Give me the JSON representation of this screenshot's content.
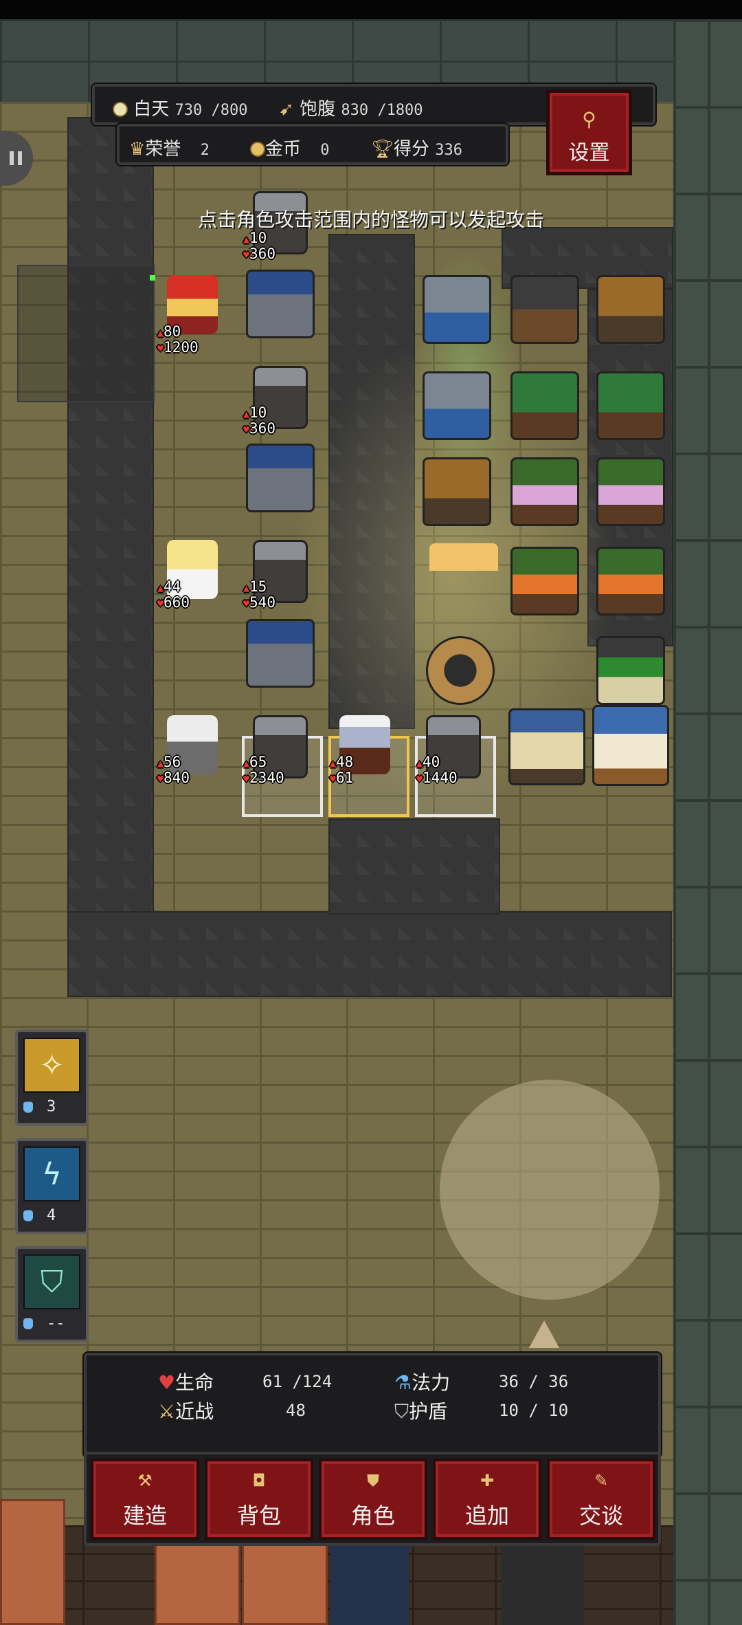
{
  "hud": {
    "day_label": "白天",
    "day_value": "730 /800",
    "hunger_label": "饱腹",
    "hunger_value": "830 /1800",
    "honor_label": "荣誉",
    "honor_value": "2",
    "gold_label": "金币",
    "gold_value": "0",
    "score_label": "得分",
    "score_value": "336",
    "settings_label": "设置"
  },
  "hint": "点击角色攻击范围内的怪物可以发起攻击",
  "units": [
    {
      "id": "guard-top",
      "atk": "10",
      "hp": "360"
    },
    {
      "id": "red-hood",
      "atk": "80",
      "hp": "1200"
    },
    {
      "id": "guard-2",
      "atk": "10",
      "hp": "360"
    },
    {
      "id": "angel",
      "atk": "44",
      "hp": "660"
    },
    {
      "id": "guard-3",
      "atk": "15",
      "hp": "540"
    },
    {
      "id": "old-knight",
      "atk": "56",
      "hp": "840"
    },
    {
      "id": "guard-4",
      "atk": "65",
      "hp": "2340"
    },
    {
      "id": "player",
      "atk": "48",
      "hp": "61"
    },
    {
      "id": "guard-5",
      "atk": "40",
      "hp": "1440"
    }
  ],
  "skills": [
    {
      "name": "holy-light",
      "count": "3",
      "color": "#f3c44a"
    },
    {
      "name": "lightning",
      "count": "4",
      "color": "#6fd3f5"
    },
    {
      "name": "shield",
      "count": "--",
      "color": "#6fc9b0"
    }
  ],
  "stats": {
    "hp_label": "生命",
    "hp_value": "61 /124",
    "mp_label": "法力",
    "mp_value": "36 / 36",
    "melee_label": "近战",
    "melee_value": "48",
    "shield_label": "护盾",
    "shield_value": "10 / 10"
  },
  "actions": {
    "build": "建造",
    "bag": "背包",
    "character": "角色",
    "add": "追加",
    "talk": "交谈"
  },
  "colors": {
    "button_red": "#7e1416",
    "panel_dark": "#1c1c1e",
    "floor": "#746d47"
  }
}
